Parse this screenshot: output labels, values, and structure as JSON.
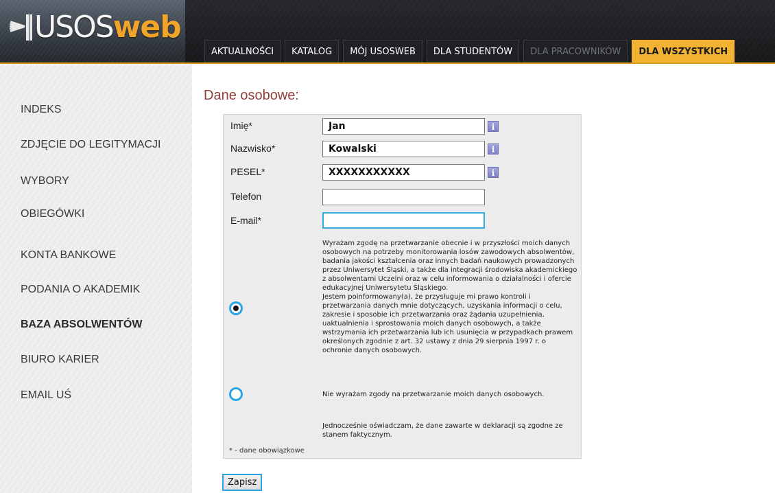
{
  "header": {
    "logo_text_1": "USOS",
    "logo_text_2": "web",
    "tabs": [
      {
        "label": "AKTUALNOŚCI"
      },
      {
        "label": "KATALOG"
      },
      {
        "label": "MÓJ USOSWEB"
      },
      {
        "label": "DLA STUDENTÓW"
      },
      {
        "label": "DLA PRACOWNIKÓW"
      },
      {
        "label": "DLA WSZYSTKICH"
      }
    ]
  },
  "sidebar": {
    "items": [
      {
        "label": "INDEKS"
      },
      {
        "label": "ZDJĘCIE DO LEGITYMACJI"
      },
      {
        "label": "WYBORY"
      },
      {
        "label": "OBIEGÓWKI"
      },
      {
        "label": "KONTA BANKOWE"
      },
      {
        "label": "PODANIA O AKADEMIK"
      },
      {
        "label": "BAZA ABSOLWENTÓW"
      },
      {
        "label": "BIURO KARIER"
      },
      {
        "label": "EMAIL UŚ"
      }
    ]
  },
  "main": {
    "title": "Dane osobowe:",
    "fields": [
      {
        "label": "Imię*",
        "value": "Jan"
      },
      {
        "label": "Nazwisko*",
        "value": "Kowalski"
      },
      {
        "label": "PESEL*",
        "value": "XXXXXXXXXXX"
      },
      {
        "label": "Telefon",
        "value": ""
      },
      {
        "label": "E-mail*",
        "value": ""
      }
    ],
    "info_icon": "i",
    "consent_yes": "Wyrażam zgodę na przetwarzanie obecnie i w przyszłości moich danych osobowych na potrzeby monitorowania losów zawodowych absolwentów, badania jakości kształcenia oraz innych badań naukowych prowadzonych przez Uniwersytet Śląski, a także dla integracji środowiska akademickiego z absolwentami Uczelni oraz w celu informowania o działalności i ofercie edukacyjnej Uniwersytetu Śląskiego.\nJestem poinformowany(a), że przysługuje mi prawo kontroli i przetwarzania danych mnie dotyczących, uzyskania informacji o celu, zakresie i sposobie ich przetwarzania oraz żądania uzupełnienia, uaktualnienia i sprostowania moich danych osobowych, a także wstrzymania ich przetwarzania lub ich usunięcia w przypadkach prawem określonych zgodnie z art. 32 ustawy z dnia 29 sierpnia 1997 r. o ochronie danych osobowych.",
    "consent_no": "Nie wyrażam zgody na przetwarzanie moich danych osobowych.",
    "declaration": "Jednocześnie oświadczam, że dane zawarte w deklaracji są zgodne ze stanem faktycznym.",
    "required_note": "* - dane obowiązkowe",
    "save_label": "Zapisz"
  },
  "colors": {
    "accent": "#f2b233",
    "focus": "#2ba4e0",
    "title": "#8f3f3a"
  },
  "icons": {
    "info": "info-icon",
    "radio": "radio-button"
  }
}
